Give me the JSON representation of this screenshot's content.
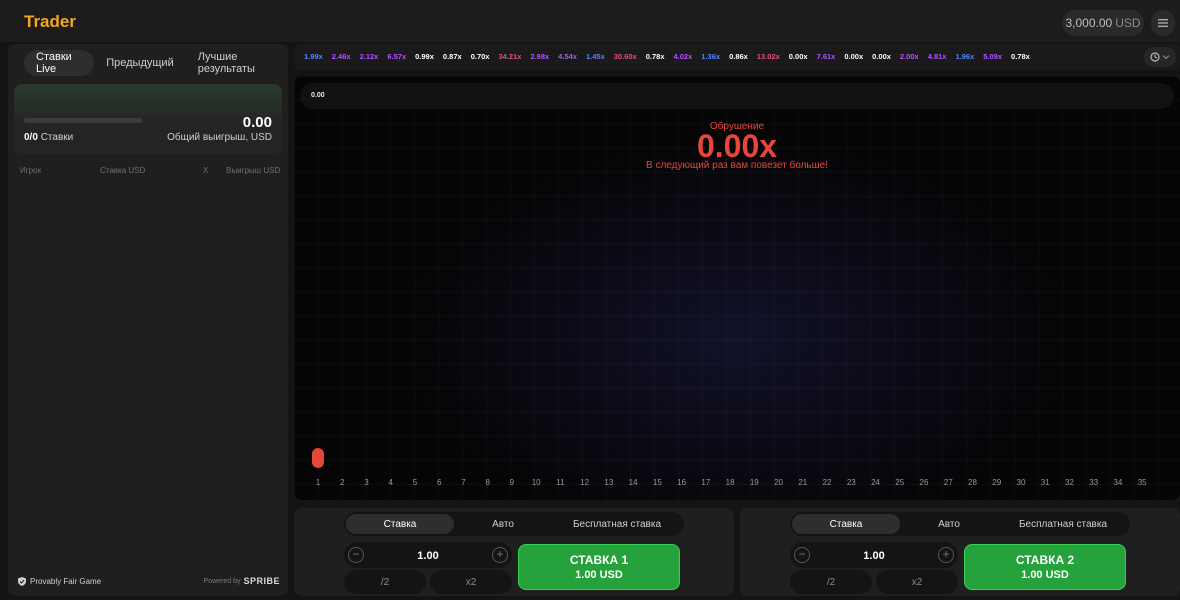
{
  "header": {
    "logo": "Trader",
    "balance_value": "3,000.00",
    "balance_currency": "USD"
  },
  "left": {
    "tabs": [
      "Ставки Live",
      "Предыдущий",
      "Лучшие результаты"
    ],
    "summary": {
      "bets_count": "0/0",
      "bets_label": "Ставки",
      "total_win": "0.00",
      "total_win_label": "Общий выигрыш, USD"
    },
    "columns": [
      "Игрок",
      "Ставка USD",
      "X",
      "Выигрыш USD"
    ],
    "footer": {
      "fair": "Provably Fair Game",
      "powered_by": "Powered by",
      "brand": "SPRIBE"
    }
  },
  "multipliers": [
    {
      "v": "1.99x",
      "c": "#4f86ff"
    },
    {
      "v": "2.46x",
      "c": "#b053ff"
    },
    {
      "v": "2.12x",
      "c": "#b053ff"
    },
    {
      "v": "6.57x",
      "c": "#b053ff"
    },
    {
      "v": "0.99x",
      "c": "#ffffff"
    },
    {
      "v": "0.87x",
      "c": "#ffffff"
    },
    {
      "v": "0.70x",
      "c": "#ffffff"
    },
    {
      "v": "34.21x",
      "c": "#e84a8a"
    },
    {
      "v": "2.98x",
      "c": "#b053ff"
    },
    {
      "v": "4.54x",
      "c": "#b053ff"
    },
    {
      "v": "1.45x",
      "c": "#4f86ff"
    },
    {
      "v": "30.60x",
      "c": "#e84a8a"
    },
    {
      "v": "0.78x",
      "c": "#ffffff"
    },
    {
      "v": "4.02x",
      "c": "#b053ff"
    },
    {
      "v": "1.36x",
      "c": "#4f86ff"
    },
    {
      "v": "0.86x",
      "c": "#ffffff"
    },
    {
      "v": "13.02x",
      "c": "#e84a8a"
    },
    {
      "v": "0.00x",
      "c": "#ffffff"
    },
    {
      "v": "7.61x",
      "c": "#b053ff"
    },
    {
      "v": "0.00x",
      "c": "#ffffff"
    },
    {
      "v": "0.00x",
      "c": "#ffffff"
    },
    {
      "v": "2.00x",
      "c": "#b053ff"
    },
    {
      "v": "4.81x",
      "c": "#b053ff"
    },
    {
      "v": "1.96x",
      "c": "#4f86ff"
    },
    {
      "v": "5.09x",
      "c": "#b053ff"
    },
    {
      "v": "0.78x",
      "c": "#ffffff"
    }
  ],
  "game": {
    "price_value": "0.00",
    "crash_label": "Обрушение",
    "crash_value": "0.00x",
    "crash_message": "В следующий раз вам повезет больше!",
    "ticks": [
      "1",
      "2",
      "3",
      "4",
      "5",
      "6",
      "7",
      "8",
      "9",
      "10",
      "11",
      "12",
      "13",
      "14",
      "15",
      "16",
      "17",
      "18",
      "19",
      "20",
      "21",
      "22",
      "23",
      "24",
      "25",
      "26",
      "27",
      "28",
      "29",
      "30",
      "31",
      "32",
      "33",
      "34",
      "35"
    ]
  },
  "bet1": {
    "tabs": [
      "Ставка",
      "Авто",
      "Бесплатная ставка"
    ],
    "amount": "1.00",
    "half": "/2",
    "double": "x2",
    "button_title": "СТАВКА 1",
    "button_amount": "1.00 USD"
  },
  "bet2": {
    "tabs": [
      "Ставка",
      "Авто",
      "Бесплатная ставка"
    ],
    "amount": "1.00",
    "half": "/2",
    "double": "x2",
    "button_title": "СТАВКА 2",
    "button_amount": "1.00 USD"
  }
}
